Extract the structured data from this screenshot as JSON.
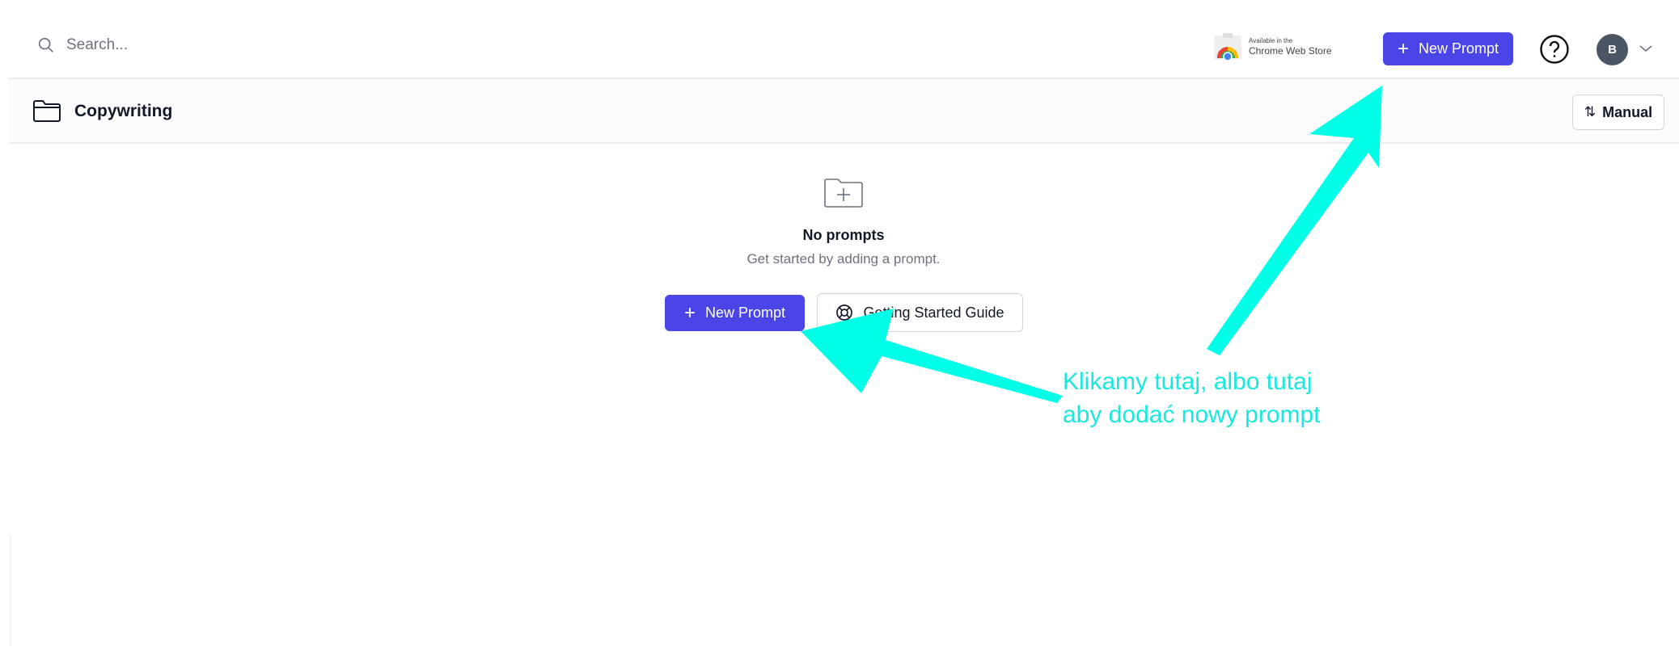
{
  "header": {
    "search": {
      "placeholder": "Search...",
      "icon": "search-icon"
    },
    "chrome_store": {
      "line1": "Available in the",
      "line2": "Chrome Web Store",
      "icon": "chrome-icon"
    },
    "new_prompt_label": "New Prompt",
    "help_icon": "question-circle-icon",
    "avatar_initial": "B",
    "menu_icon": "chevron-down-icon"
  },
  "folder": {
    "title": "Copywriting",
    "icon": "folder-icon",
    "sort_label": "Manual",
    "sort_icon": "sort-arrows-icon"
  },
  "empty_state": {
    "icon": "folder-plus-icon",
    "title": "No prompts",
    "subtitle": "Get started by adding a prompt.",
    "primary_label": "New Prompt",
    "secondary_label": "Getting Started Guide",
    "secondary_icon": "lifebuoy-icon"
  },
  "annotation": {
    "line1": "Klikamy tutaj, albo tutaj",
    "line2": "aby dodać nowy prompt",
    "color": "#19e8df"
  },
  "colors": {
    "accent": "#4b45e8",
    "annotation": "#19e8df"
  }
}
